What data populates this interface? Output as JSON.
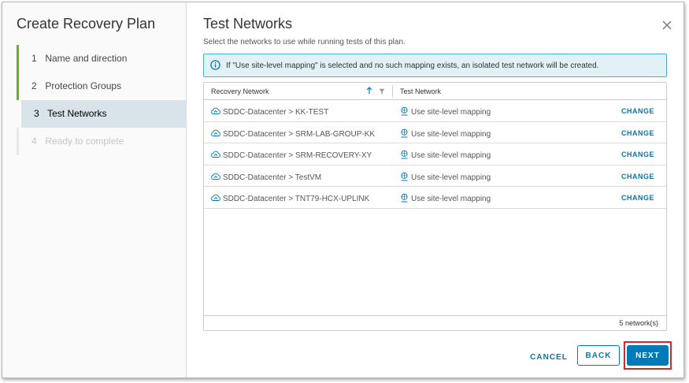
{
  "wizard": {
    "title": "Create Recovery Plan",
    "steps": [
      {
        "num": "1",
        "label": "Name and direction"
      },
      {
        "num": "2",
        "label": "Protection Groups"
      },
      {
        "num": "3",
        "label": "Test Networks"
      },
      {
        "num": "4",
        "label": "Ready to complete"
      }
    ]
  },
  "page": {
    "title": "Test Networks",
    "subtitle": "Select the networks to use while running tests of this plan.",
    "info": "If \"Use site-level mapping\" is selected and no such mapping exists, an isolated test network will be created."
  },
  "grid": {
    "columns": [
      "Recovery Network",
      "Test Network"
    ],
    "rows": [
      {
        "recovery": "SDDC-Datacenter > KK-TEST",
        "test": "Use site-level mapping",
        "action": "CHANGE"
      },
      {
        "recovery": "SDDC-Datacenter > SRM-LAB-GROUP-KK",
        "test": "Use site-level mapping",
        "action": "CHANGE"
      },
      {
        "recovery": "SDDC-Datacenter > SRM-RECOVERY-XY",
        "test": "Use site-level mapping",
        "action": "CHANGE"
      },
      {
        "recovery": "SDDC-Datacenter > TestVM",
        "test": "Use site-level mapping",
        "action": "CHANGE"
      },
      {
        "recovery": "SDDC-Datacenter > TNT79-HCX-UPLINK",
        "test": "Use site-level mapping",
        "action": "CHANGE"
      }
    ],
    "footer": "5 network(s)"
  },
  "buttons": {
    "cancel": "CANCEL",
    "back": "BACK",
    "next": "NEXT"
  },
  "colors": {
    "accent": "#0079b8",
    "step_done": "#60b515",
    "highlight": "#d9262e"
  }
}
